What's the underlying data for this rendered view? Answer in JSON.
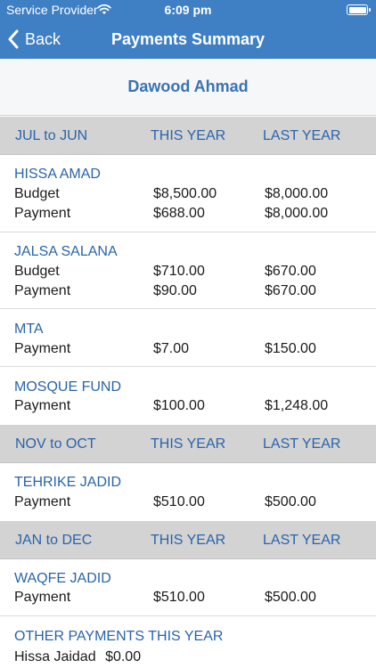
{
  "status_bar": {
    "carrier": "Service Provider",
    "time": "6:09 pm"
  },
  "nav": {
    "back_label": "Back",
    "title": "Payments Summary"
  },
  "member_name": "Dawood Ahmad",
  "sections": [
    {
      "period": "JUL to JUN",
      "this_year": "THIS YEAR",
      "last_year": "LAST YEAR"
    },
    {
      "period": "NOV to OCT",
      "this_year": "THIS YEAR",
      "last_year": "LAST YEAR"
    },
    {
      "period": "JAN to DEC",
      "this_year": "THIS YEAR",
      "last_year": "LAST YEAR"
    }
  ],
  "items": [
    {
      "title": "HISSA AMAD",
      "rows": [
        {
          "label": "Budget",
          "this_year": "$8,500.00",
          "last_year": "$8,000.00"
        },
        {
          "label": "Payment",
          "this_year": "$688.00",
          "last_year": "$8,000.00"
        }
      ]
    },
    {
      "title": "JALSA SALANA",
      "rows": [
        {
          "label": "Budget",
          "this_year": "$710.00",
          "last_year": "$670.00"
        },
        {
          "label": "Payment",
          "this_year": "$90.00",
          "last_year": "$670.00"
        }
      ]
    },
    {
      "title": "MTA",
      "rows": [
        {
          "label": "Payment",
          "this_year": "$7.00",
          "last_year": "$150.00"
        }
      ]
    },
    {
      "title": "MOSQUE FUND",
      "rows": [
        {
          "label": "Payment",
          "this_year": "$100.00",
          "last_year": "$1,248.00"
        }
      ]
    },
    {
      "title": "TEHRIKE JADID",
      "rows": [
        {
          "label": "Payment",
          "this_year": "$510.00",
          "last_year": "$500.00"
        }
      ]
    },
    {
      "title": "WAQFE JADID",
      "rows": [
        {
          "label": "Payment",
          "this_year": "$510.00",
          "last_year": "$500.00"
        }
      ]
    }
  ],
  "other_payments": {
    "title": "OTHER PAYMENTS THIS YEAR",
    "label": "Hissa Jaidad",
    "amount": "$0.00"
  }
}
